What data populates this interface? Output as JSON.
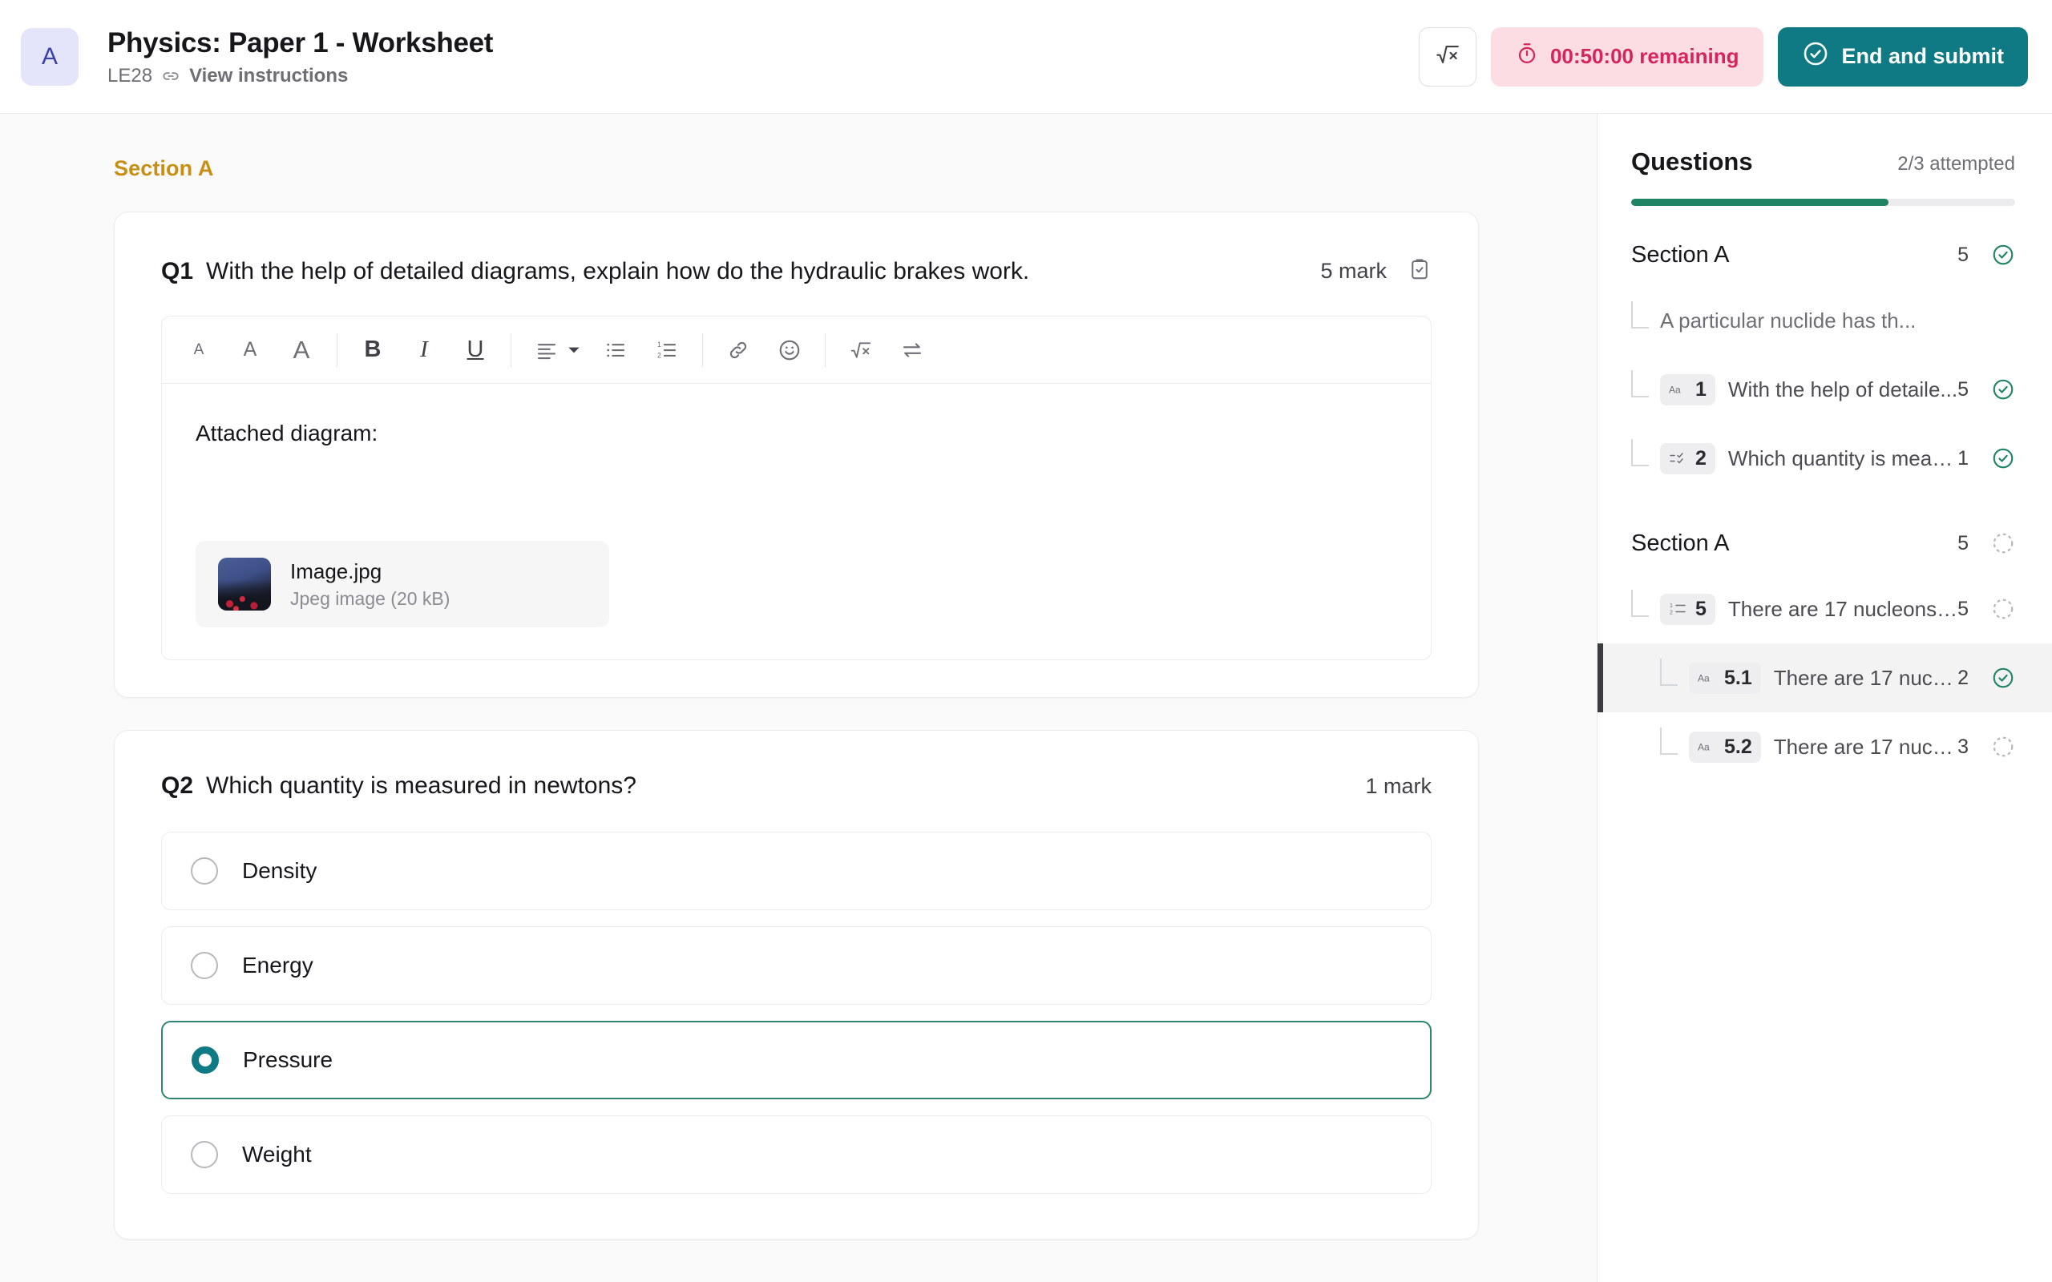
{
  "header": {
    "avatar_letter": "A",
    "title": "Physics: Paper 1 - Worksheet",
    "code": "LE28",
    "instructions_link": "View instructions",
    "link_icon": "link-icon",
    "equation_icon": "square-root-icon",
    "timer_icon": "stopwatch-icon",
    "timer_text": "00:50:00 remaining",
    "submit_icon": "check-circle-icon",
    "submit_label": "End and submit",
    "colors": {
      "teal": "#0f7a83",
      "timer_bg": "#fbdde3",
      "timer_fg": "#d5255b",
      "avatar_bg": "#e4e4fa",
      "avatar_fg": "#3b3fa8"
    }
  },
  "main": {
    "section_label": "Section A",
    "section_label_color": "#c98f14",
    "questions": [
      {
        "num": "Q1",
        "text": "With the help of detailed diagrams, explain how do the hydraulic brakes work.",
        "mark": "5 mark",
        "status_icon": "clipboard-check-icon",
        "type": "rich-text",
        "toolbar": [
          {
            "name": "font-size-small-icon",
            "glyph": "A"
          },
          {
            "name": "font-size-medium-icon",
            "glyph": "A"
          },
          {
            "name": "font-size-large-icon",
            "glyph": "A"
          },
          {
            "name": "bold-icon",
            "glyph": "B"
          },
          {
            "name": "italic-icon",
            "glyph": "I"
          },
          {
            "name": "underline-icon",
            "glyph": "U"
          },
          {
            "name": "align-icon",
            "glyph": "align"
          },
          {
            "name": "bulleted-list-icon",
            "glyph": "ul"
          },
          {
            "name": "numbered-list-icon",
            "glyph": "ol"
          },
          {
            "name": "link-icon",
            "glyph": "link"
          },
          {
            "name": "emoji-icon",
            "glyph": "emoji"
          },
          {
            "name": "equation-icon",
            "glyph": "sqrt"
          },
          {
            "name": "special-character-icon",
            "glyph": "arrows"
          }
        ],
        "answer_text": "Attached diagram:",
        "attachment": {
          "name": "Image.jpg",
          "meta": "Jpeg image (20 kB)"
        }
      },
      {
        "num": "Q2",
        "text": "Which quantity is measured in newtons?",
        "mark": "1 mark",
        "type": "mcq",
        "options": [
          {
            "label": "Density",
            "selected": false
          },
          {
            "label": "Energy",
            "selected": false
          },
          {
            "label": "Pressure",
            "selected": true
          },
          {
            "label": "Weight",
            "selected": false
          }
        ]
      }
    ]
  },
  "sidebar": {
    "title": "Questions",
    "attempted": "2/3 attempted",
    "progress_percent": 67,
    "progress_color": "#1f8464",
    "groups": [
      {
        "name": "Section A",
        "points": "5",
        "status": "done",
        "items": [
          {
            "kind": "plain",
            "label": "A particular nuclide has th...",
            "points": "",
            "status": "none",
            "depth": 1
          },
          {
            "kind": "badge",
            "badge_icon": "text-icon",
            "badge_glyph": "Aa",
            "number": "1",
            "label": "With the help of detaile...",
            "points": "5",
            "status": "done",
            "depth": 1
          },
          {
            "kind": "badge",
            "badge_icon": "mcq-icon",
            "badge_glyph": "checklist",
            "number": "2",
            "label": "Which quantity is measu...",
            "points": "1",
            "status": "done",
            "depth": 1
          }
        ]
      },
      {
        "name": "Section A",
        "points": "5",
        "status": "pending",
        "items": [
          {
            "kind": "badge",
            "badge_icon": "numbered-list-icon",
            "badge_glyph": "ol",
            "number": "5",
            "label": "There are 17 nucleons in...",
            "points": "5",
            "status": "pending",
            "depth": 1
          },
          {
            "kind": "badge",
            "badge_icon": "text-icon",
            "badge_glyph": "Aa",
            "number": "5.1",
            "label": "There are 17 nuclin...",
            "points": "2",
            "status": "done",
            "depth": 2,
            "active": true
          },
          {
            "kind": "badge",
            "badge_icon": "text-icon",
            "badge_glyph": "Aa",
            "number": "5.2",
            "label": "There are 17 nuclin...",
            "points": "3",
            "status": "pending",
            "depth": 2
          }
        ]
      }
    ]
  }
}
